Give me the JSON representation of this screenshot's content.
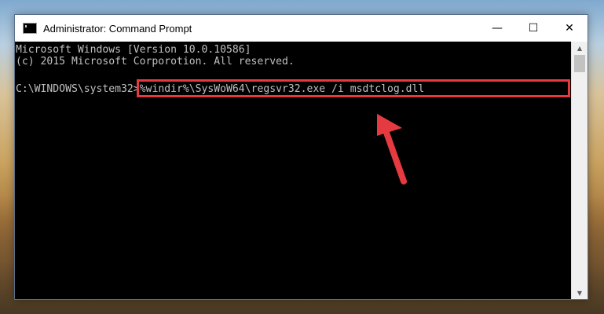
{
  "window": {
    "title": "Administrator: Command Prompt",
    "icon": "cmd-icon"
  },
  "controls": {
    "minimize_glyph": "—",
    "maximize_glyph": "☐",
    "close_glyph": "✕"
  },
  "console": {
    "line1": "Microsoft Windows [Version 10.0.10586]",
    "line2": "(c) 2015 Microsoft Corporotion. All reserved.",
    "prompt": "C:\\WINDOWS\\system32>",
    "command": "%windir%\\SysWoW64\\regsvr32.exe /i msdtclog.dll"
  },
  "annotation": {
    "highlight_color": "#e53a3f",
    "arrow_color": "#e53a3f"
  },
  "colors": {
    "console_bg": "#000000",
    "console_text": "#c0c0c0"
  },
  "scrollbar": {
    "up_glyph": "▲",
    "down_glyph": "▼"
  }
}
